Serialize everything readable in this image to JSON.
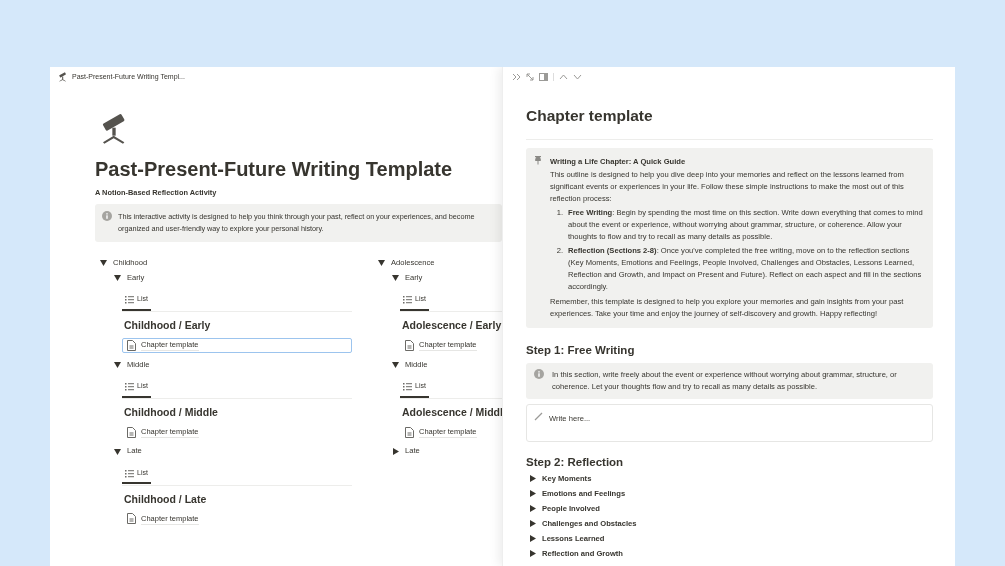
{
  "breadcrumb": {
    "title": "Past-Present-Future Writing Templ..."
  },
  "page": {
    "title": "Past-Present-Future Writing Template",
    "subtitle": "A Notion-Based Reflection Activity",
    "callout": [
      "This interactive activity is designed to help you think through your past, reflect on your experiences, and become",
      "organized and user-friendly way to explore your personal history."
    ],
    "sections": [
      {
        "label": "Childhood",
        "expanded": true,
        "children": [
          {
            "label": "Early",
            "expanded": true,
            "view_tab": "List",
            "heading": "Childhood / Early",
            "items": [
              {
                "label": "Chapter template",
                "selected": true
              }
            ]
          },
          {
            "label": "Middle",
            "expanded": true,
            "view_tab": "List",
            "heading": "Childhood / Middle",
            "items": [
              {
                "label": "Chapter template",
                "selected": false
              }
            ]
          },
          {
            "label": "Late",
            "expanded": true,
            "view_tab": "List",
            "heading": "Childhood / Late",
            "items": [
              {
                "label": "Chapter template",
                "selected": false
              }
            ]
          }
        ]
      },
      {
        "label": "Adolescence",
        "expanded": true,
        "children": [
          {
            "label": "Early",
            "expanded": true,
            "view_tab": "List",
            "heading": "Adolescence / Early",
            "items": [
              {
                "label": "Chapter template",
                "selected": false
              }
            ]
          },
          {
            "label": "Middle",
            "expanded": true,
            "view_tab": "List",
            "heading": "Adolescence / Middl",
            "items": [
              {
                "label": "Chapter template",
                "selected": false
              }
            ]
          },
          {
            "label": "Late",
            "expanded": false
          }
        ]
      }
    ]
  },
  "side_peek": {
    "title": "Chapter template",
    "guide": {
      "title": "Writing a Life Chapter: A Quick Guide",
      "intro": "This outline is designed to help you dive deep into your memories and reflect on the lessons learned from significant events or experiences in your life. Follow these simple instructions to make the most out of this reflection process:",
      "steps": [
        {
          "number": "1.",
          "text": "**Free Writing**: Begin by spending the most time on this section. Write down everything that comes to mind about the event or experience, without worrying about grammar, structure, or coherence. Allow your thoughts to flow and try to recall as many details as possible."
        },
        {
          "number": "2.",
          "text": "**Reflection (Sections 2-8)**: Once you've completed the free writing, move on to the reflection sections (Key Moments, Emotions and Feelings, People Involved, Challenges and Obstacles, Lessons Learned, Reflection and Growth, and Impact on Present and Future). Reflect on each aspect and fill in the sections accordingly."
        }
      ],
      "outro": "Remember, this template is designed to help you explore your memories and gain insights from your past experiences. Take your time and enjoy the journey of self-discovery and growth. Happy reflecting!"
    },
    "step1": {
      "heading": "Step 1: Free Writing",
      "callout": "In this section, write freely about the event or experience without worrying about grammar, structure, or coherence. Let your thoughts flow and try to recall as many details as possible.",
      "placeholder": "Write here..."
    },
    "step2": {
      "heading": "Step 2: Reflection",
      "toggles": [
        {
          "label": "Key Moments",
          "expanded": false
        },
        {
          "label": "Emotions and Feelings",
          "expanded": false
        },
        {
          "label": "People Involved",
          "expanded": false
        },
        {
          "label": "Challenges and Obstacles",
          "expanded": false
        },
        {
          "label": "Lessons Learned",
          "expanded": false
        },
        {
          "label": "Reflection and Growth",
          "expanded": false
        }
      ]
    }
  }
}
